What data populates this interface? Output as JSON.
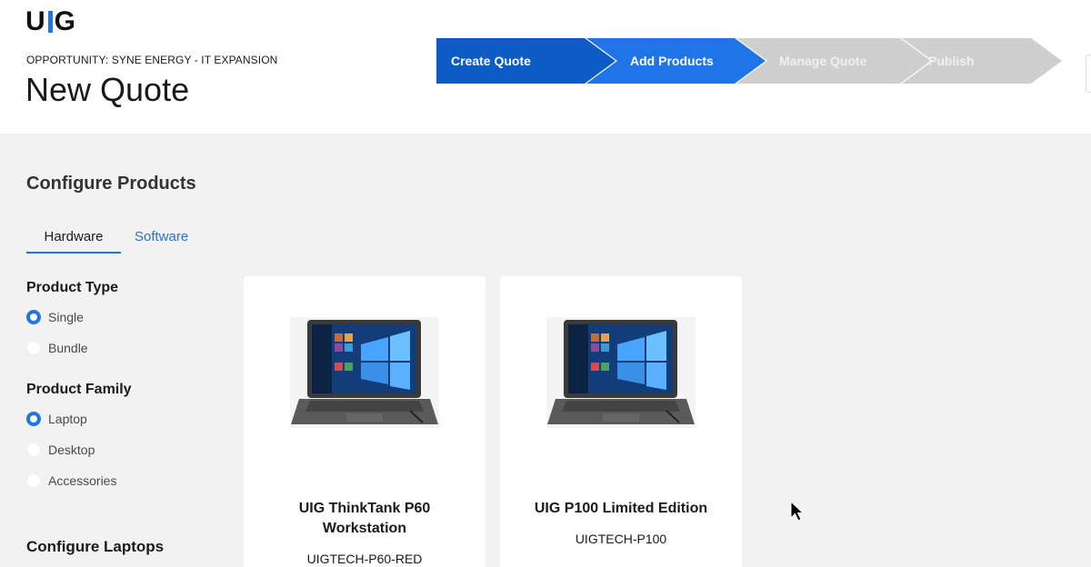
{
  "header": {
    "logo": "UIG",
    "opportunity": "OPPORTUNITY: SYNE ENERGY - IT EXPANSION",
    "title": "New Quote"
  },
  "stepper": {
    "steps": [
      {
        "label": "Create Quote",
        "state": "complete",
        "color": "#0d5bc4"
      },
      {
        "label": "Add Products",
        "state": "current",
        "color": "#1f74e8"
      },
      {
        "label": "Manage Quote",
        "state": "upcoming",
        "color": "#cfcfcf"
      },
      {
        "label": "Publish",
        "state": "upcoming",
        "color": "#cfcfcf"
      }
    ]
  },
  "main": {
    "section_title": "Configure Products",
    "tabs": [
      {
        "label": "Hardware",
        "active": true
      },
      {
        "label": "Software",
        "active": false
      }
    ]
  },
  "filters": {
    "product_type": {
      "heading": "Product Type",
      "options": [
        {
          "label": "Single",
          "selected": true
        },
        {
          "label": "Bundle",
          "selected": false
        }
      ]
    },
    "product_family": {
      "heading": "Product Family",
      "options": [
        {
          "label": "Laptop",
          "selected": true
        },
        {
          "label": "Desktop",
          "selected": false
        },
        {
          "label": "Accessories",
          "selected": false
        }
      ]
    },
    "configure_heading": "Configure Laptops"
  },
  "products": [
    {
      "name_line1": "UIG ThinkTank P60",
      "name_line2": "Workstation",
      "sku": "UIGTECH-P60-RED",
      "image": "laptop-image"
    },
    {
      "name_line1": "UIG P100 Limited Edition",
      "name_line2": "",
      "sku": "UIGTECH-P100",
      "image": "laptop-image"
    }
  ],
  "colors": {
    "accent": "#1f74e8",
    "accent_dark": "#0d5bc4",
    "step_inactive": "#cfcfcf",
    "background": "#f2f2f2"
  }
}
